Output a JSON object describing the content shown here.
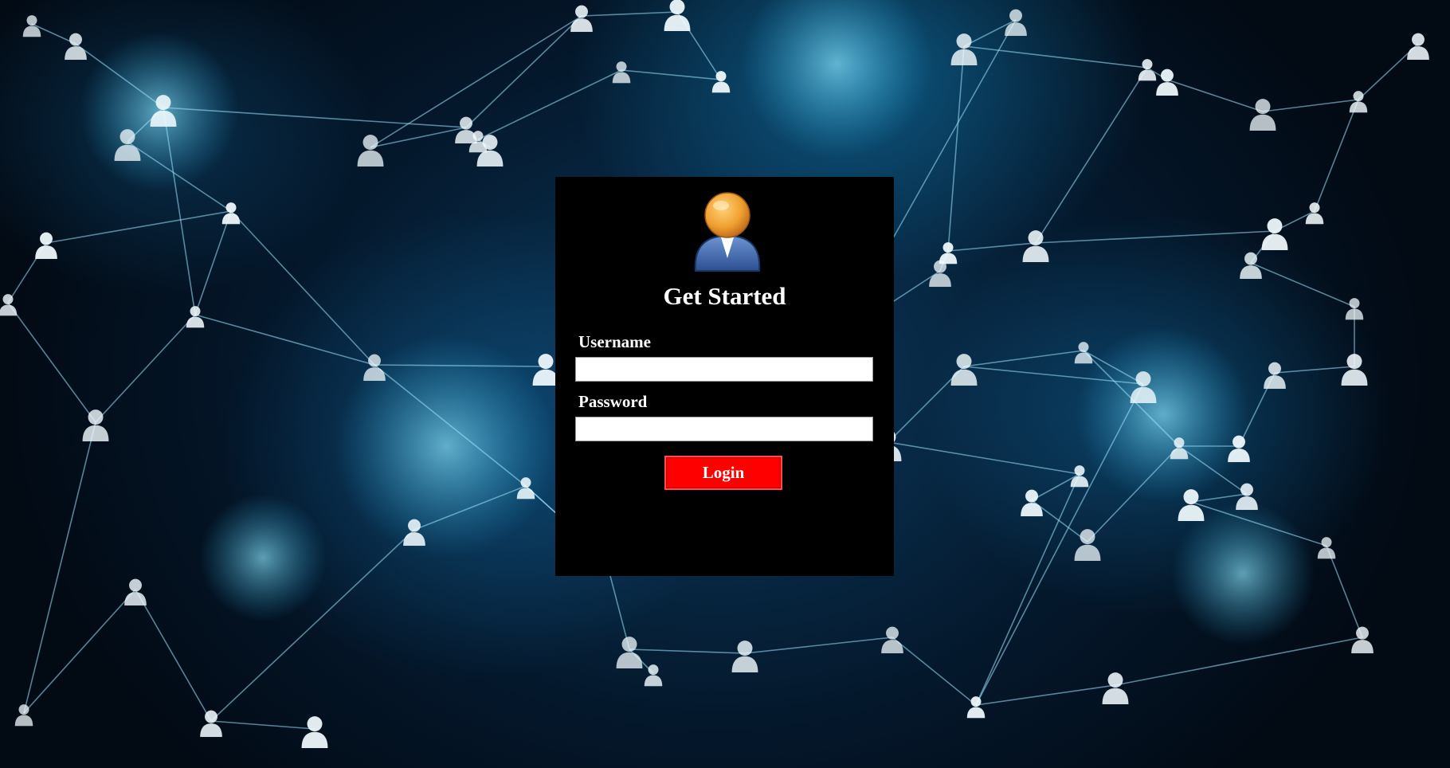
{
  "background": {
    "description_icon": "person-network-icon",
    "base_color": "#04182c",
    "glow_color": "#66ddff"
  },
  "login_panel": {
    "avatar_icon": "user-avatar-icon",
    "title": "Get Started",
    "username": {
      "label": "Username",
      "value": "",
      "placeholder": ""
    },
    "password": {
      "label": "Password",
      "value": "",
      "placeholder": ""
    },
    "login_button_label": "Login",
    "colors": {
      "panel_bg": "#000000",
      "button_bg": "#ff0000",
      "text": "#ffffff"
    }
  }
}
